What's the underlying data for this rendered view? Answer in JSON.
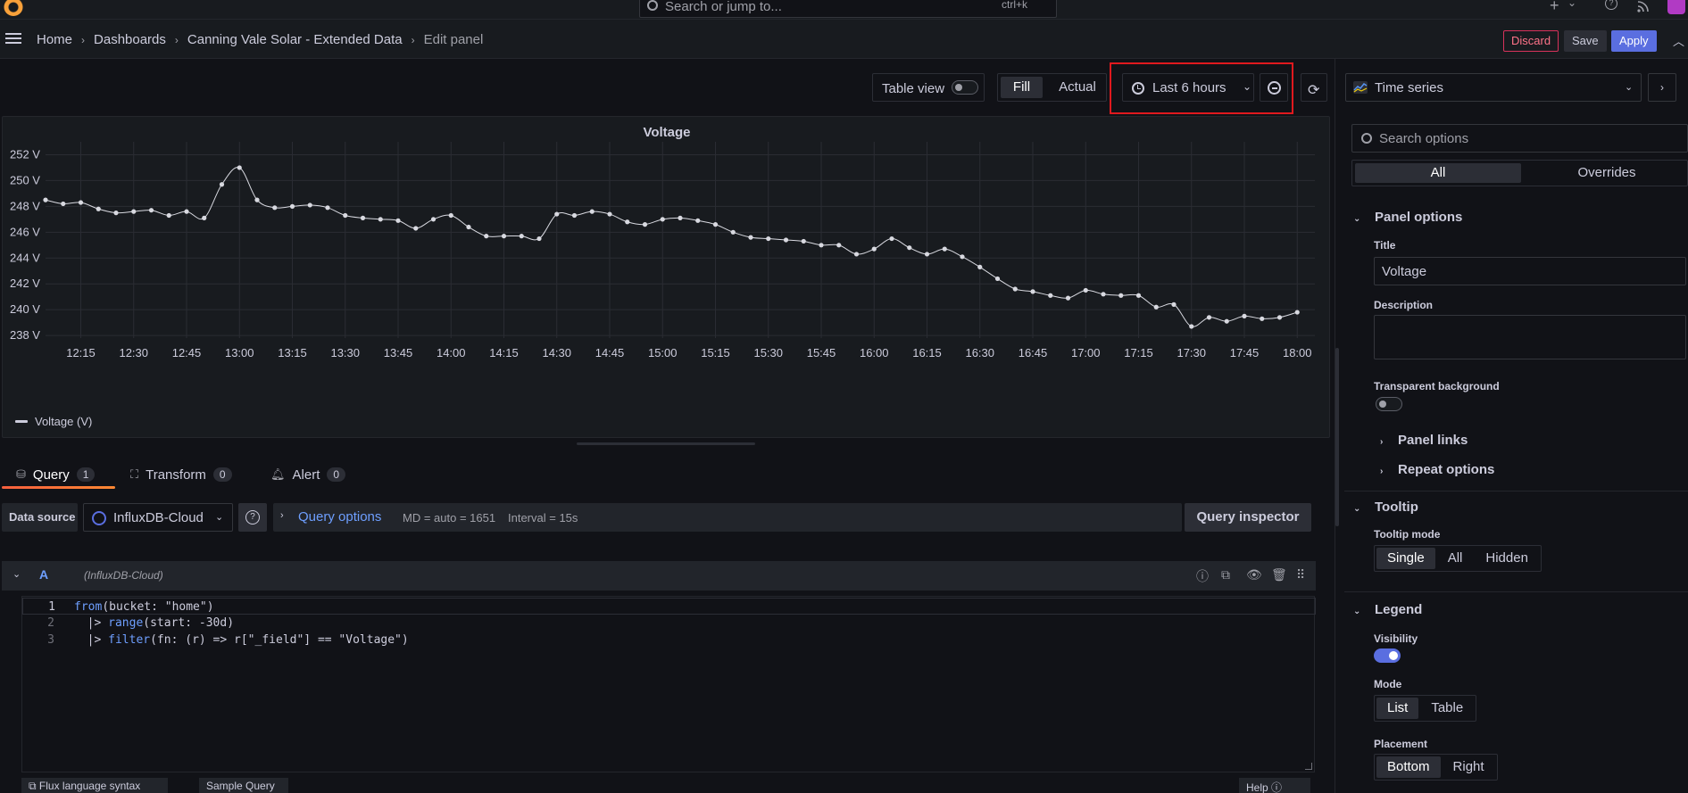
{
  "topbar": {
    "search_placeholder": "Search or jump to...",
    "search_shortcut": "ctrl+k",
    "plus_icon": "+",
    "plus_chevron": "⌄",
    "help_icon": "?",
    "news_icon": "rss",
    "avatar_icon": "avatar"
  },
  "breadcrumb": {
    "items": [
      "Home",
      "Dashboards",
      "Canning Vale Solar - Extended Data",
      "Edit panel"
    ],
    "separator": "›"
  },
  "actions": {
    "discard": "Discard",
    "save": "Save",
    "apply": "Apply"
  },
  "toolbar": {
    "table_view": "Table view",
    "table_view_on": false,
    "fill": "Fill",
    "actual": "Actual",
    "time_range": "Last 6 hours"
  },
  "panel": {
    "title": "Voltage",
    "legend": "Voltage (V)"
  },
  "chart_data": {
    "type": "line",
    "title": "Voltage",
    "series_name": "Voltage (V)",
    "ylim": [
      237.8,
      253
    ],
    "y_ticks": [
      252,
      250,
      248,
      246,
      244,
      242,
      240,
      238
    ],
    "y_tick_labels": [
      "252 V",
      "250 V",
      "248 V",
      "246 V",
      "244 V",
      "242 V",
      "240 V",
      "238 V"
    ],
    "x_start": "12:05",
    "x_end": "18:05",
    "x_ticks": [
      "12:15",
      "12:30",
      "12:45",
      "13:00",
      "13:15",
      "13:30",
      "13:45",
      "14:00",
      "14:15",
      "14:30",
      "14:45",
      "15:00",
      "15:15",
      "15:30",
      "15:45",
      "16:00",
      "16:15",
      "16:30",
      "16:45",
      "17:00",
      "17:15",
      "17:30",
      "17:45",
      "18:00"
    ],
    "x": [
      "12:05",
      "12:10",
      "12:15",
      "12:20",
      "12:25",
      "12:30",
      "12:35",
      "12:40",
      "12:45",
      "12:50",
      "12:55",
      "13:00",
      "13:05",
      "13:10",
      "13:15",
      "13:20",
      "13:25",
      "13:30",
      "13:35",
      "13:40",
      "13:45",
      "13:50",
      "13:55",
      "14:00",
      "14:05",
      "14:10",
      "14:15",
      "14:20",
      "14:25",
      "14:30",
      "14:35",
      "14:40",
      "14:45",
      "14:50",
      "14:55",
      "15:00",
      "15:05",
      "15:10",
      "15:15",
      "15:20",
      "15:25",
      "15:30",
      "15:35",
      "15:40",
      "15:45",
      "15:50",
      "15:55",
      "16:00",
      "16:05",
      "16:10",
      "16:15",
      "16:20",
      "16:25",
      "16:30",
      "16:35",
      "16:40",
      "16:45",
      "16:50",
      "16:55",
      "17:00",
      "17:05",
      "17:10",
      "17:15",
      "17:20",
      "17:25",
      "17:30",
      "17:35",
      "17:40",
      "17:45",
      "17:50",
      "17:55",
      "18:00"
    ],
    "values": [
      248.5,
      248.2,
      248.3,
      247.8,
      247.5,
      247.6,
      247.7,
      247.3,
      247.6,
      247.1,
      249.7,
      251.0,
      248.5,
      247.9,
      248.0,
      248.1,
      247.9,
      247.3,
      247.1,
      247.0,
      246.9,
      246.3,
      247.0,
      247.3,
      246.4,
      245.7,
      245.7,
      245.7,
      245.5,
      247.4,
      247.3,
      247.6,
      247.4,
      246.8,
      246.6,
      247.0,
      247.1,
      246.9,
      246.6,
      246.0,
      245.6,
      245.5,
      245.4,
      245.3,
      245.0,
      245.0,
      244.3,
      244.7,
      245.5,
      244.8,
      244.3,
      244.7,
      244.1,
      243.3,
      242.4,
      241.6,
      241.4,
      241.1,
      240.9,
      241.5,
      241.2,
      241.1,
      241.1,
      240.2,
      240.4,
      238.7,
      239.4,
      239.1,
      239.5,
      239.3,
      239.4,
      239.8
    ],
    "grid": true,
    "legend_placement": "bottom-left",
    "line_color": "#d8d9e0"
  },
  "query_tabs": [
    {
      "label": "Query",
      "count": "1"
    },
    {
      "label": "Transform",
      "count": "0"
    },
    {
      "label": "Alert",
      "count": "0"
    }
  ],
  "datasource": {
    "label": "Data source",
    "name": "InfluxDB-Cloud",
    "query_options": "Query options",
    "md": "MD = auto = 1651",
    "interval": "Interval = 15s",
    "inspector": "Query inspector"
  },
  "query": {
    "letter": "A",
    "ds": "(InfluxDB-Cloud)",
    "lines": [
      {
        "num": "1",
        "fn": "from",
        "rest": "(bucket: \"home\")",
        "indent": ""
      },
      {
        "num": "2",
        "fn": "range",
        "rest": "(start: -30d)",
        "indent": "  |> "
      },
      {
        "num": "3",
        "fn": "filter",
        "rest": "(fn: (r) => r[\"_field\"] == \"Voltage\")",
        "indent": "  |> "
      }
    ]
  },
  "bottom": {
    "syntax": "Flux language syntax",
    "sample": "Sample Query",
    "help": "Help"
  },
  "right": {
    "viz": "Time series",
    "search_placeholder": "Search options",
    "tab_all": "All",
    "tab_overrides": "Overrides",
    "panel_options": "Panel options",
    "title_label": "Title",
    "title_value": "Voltage",
    "description_label": "Description",
    "transparent_label": "Transparent background",
    "panel_links": "Panel links",
    "repeat_options": "Repeat options",
    "tooltip": "Tooltip",
    "tooltip_mode_label": "Tooltip mode",
    "tooltip_modes": [
      "Single",
      "All",
      "Hidden"
    ],
    "legend": "Legend",
    "visibility_label": "Visibility",
    "mode_label": "Mode",
    "modes": [
      "List",
      "Table"
    ],
    "placement_label": "Placement",
    "placements": [
      "Bottom",
      "Right"
    ]
  },
  "colors": {
    "accent": "#5a6ee0",
    "highlight": "#e0191e",
    "query_tab": "#ff8833",
    "link": "#6e9fff"
  }
}
